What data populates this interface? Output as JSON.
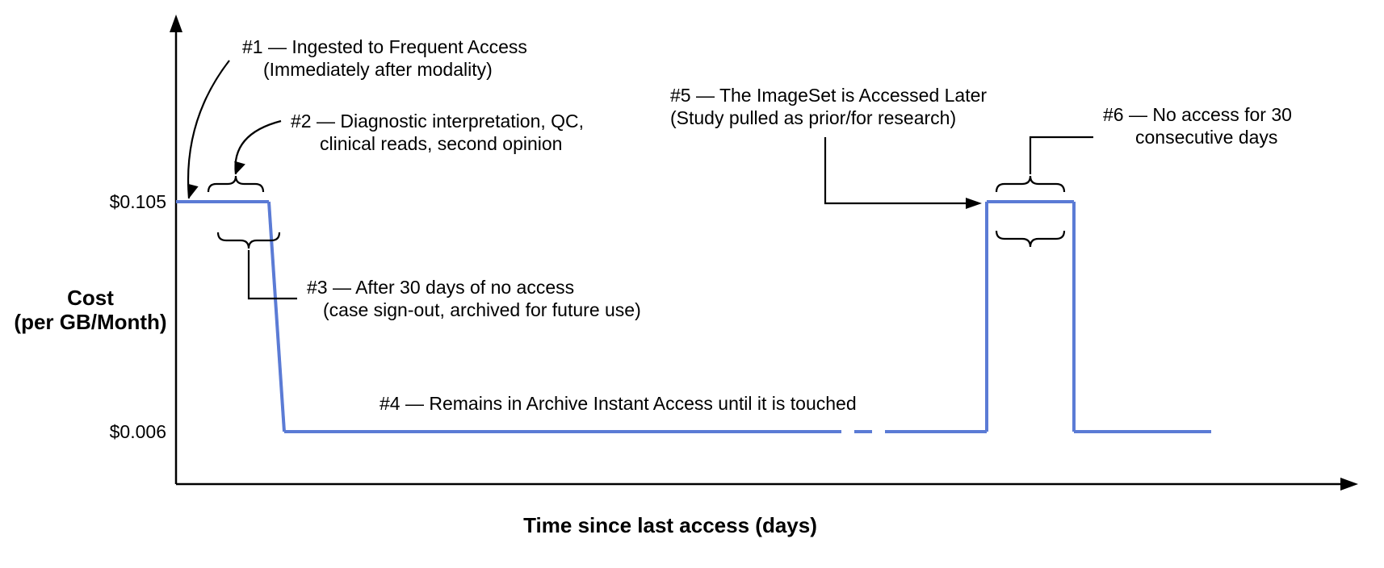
{
  "chart_data": {
    "type": "line",
    "title": "",
    "xlabel": "Time since last access (days)",
    "ylabel_line1": "Cost",
    "ylabel_line2": "(per GB/Month)",
    "y_ticks": {
      "high_label": "$0.105",
      "high": 0.105,
      "low_label": "$0.006",
      "low": 0.006
    },
    "x_range_note": "qualitative timeline (days) – no numeric ticks shown",
    "series": [
      {
        "name": "storage_cost",
        "segments": [
          {
            "phase": "frequent_access_initial",
            "cost": 0.105
          },
          {
            "phase": "drop_after_30_days_no_access",
            "cost_from": 0.105,
            "cost_to": 0.006
          },
          {
            "phase": "archive_instant_access",
            "cost": 0.006
          },
          {
            "phase": "time_gap_dashed",
            "cost": 0.006
          },
          {
            "phase": "accessed_later_back_to_frequent",
            "cost": 0.105
          },
          {
            "phase": "drop_after_30_days_again",
            "cost_from": 0.105,
            "cost_to": 0.006
          },
          {
            "phase": "archive_again",
            "cost": 0.006
          }
        ]
      }
    ],
    "annotations": {
      "a1_line1": "#1 — Ingested to Frequent Access",
      "a1_line2": "(Immediately after modality)",
      "a2_line1": "#2 — Diagnostic interpretation, QC,",
      "a2_line2": "clinical reads, second opinion",
      "a3_line1": "#3 — After 30 days of no access",
      "a3_line2": "(case sign-out, archived for future use)",
      "a4": "#4 — Remains in Archive Instant Access until it is touched",
      "a5_line1": "#5 — The ImageSet is Accessed Later",
      "a5_line2": "(Study pulled as prior/for research)",
      "a6_line1": "#6 — No access for 30",
      "a6_line2": "consecutive days"
    }
  }
}
